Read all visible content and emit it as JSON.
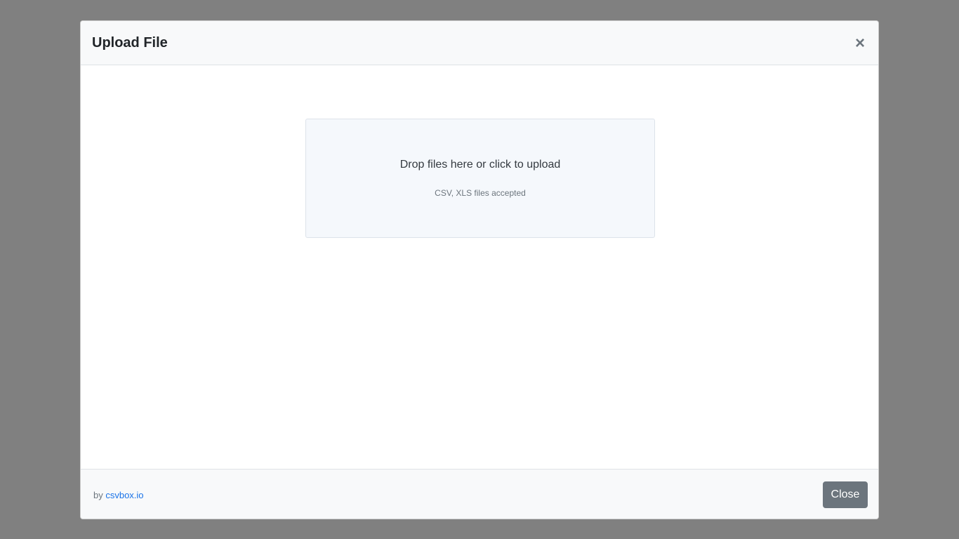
{
  "modal": {
    "title": "Upload File",
    "close_symbol": "×"
  },
  "dropzone": {
    "title": "Drop files here or click to upload",
    "subtitle": "CSV, XLS files accepted"
  },
  "footer": {
    "by_text": "by ",
    "brand_link": "csvbox.io",
    "close_label": "Close"
  },
  "colors": {
    "backdrop": "#808080",
    "header_bg": "#f8f9fa",
    "dropzone_bg": "#f5f8fc",
    "link": "#1a73e8",
    "close_button_bg": "#6c757d"
  }
}
